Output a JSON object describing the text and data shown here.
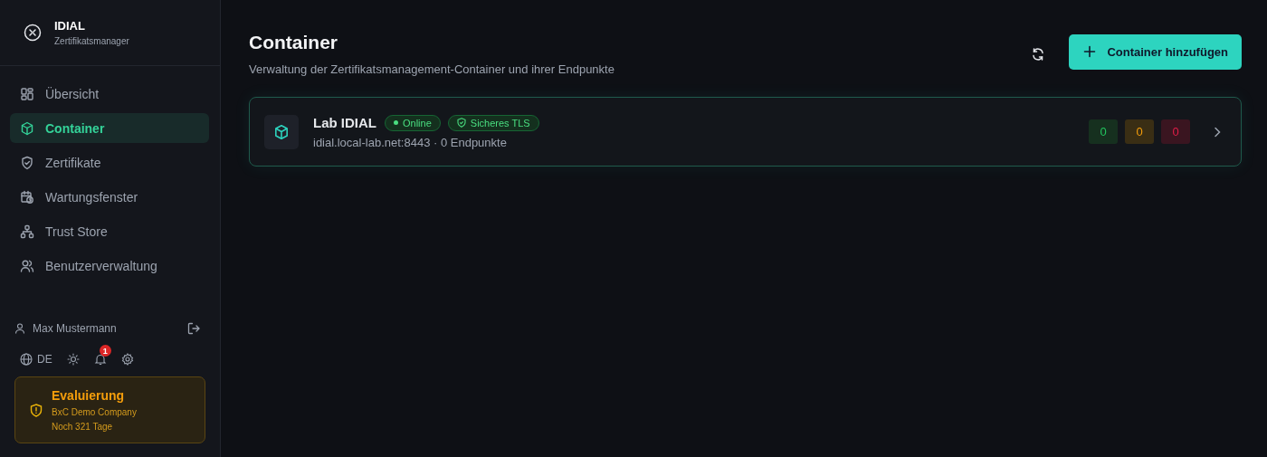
{
  "brand": {
    "name": "IDIAL",
    "subtitle": "Zertifikatsmanager"
  },
  "nav": [
    {
      "label": "Übersicht",
      "selected": false
    },
    {
      "label": "Container",
      "selected": true
    },
    {
      "label": "Zertifikate",
      "selected": false
    },
    {
      "label": "Wartungsfenster",
      "selected": false
    },
    {
      "label": "Trust Store",
      "selected": false
    },
    {
      "label": "Benutzerverwaltung",
      "selected": false
    }
  ],
  "user": {
    "name": "Max Mustermann"
  },
  "language": "DE",
  "notifications": {
    "count": "1"
  },
  "license": {
    "title": "Evaluierung",
    "company": "BxC Demo Company",
    "remaining": "Noch 321 Tage"
  },
  "page": {
    "title": "Container",
    "subtitle": "Verwaltung der Zertifikatsmanagement-Container und ihrer Endpunkte",
    "add_button": "Container hinzufügen"
  },
  "containers": [
    {
      "name": "Lab IDIAL",
      "status": "Online",
      "tls": "Sicheres TLS",
      "address": "idial.local-lab.net:8443 · 0 Endpunkte",
      "counts": [
        {
          "value": "0",
          "kind": "ok"
        },
        {
          "value": "0",
          "kind": "warning"
        },
        {
          "value": "0",
          "kind": "error"
        }
      ]
    }
  ]
}
